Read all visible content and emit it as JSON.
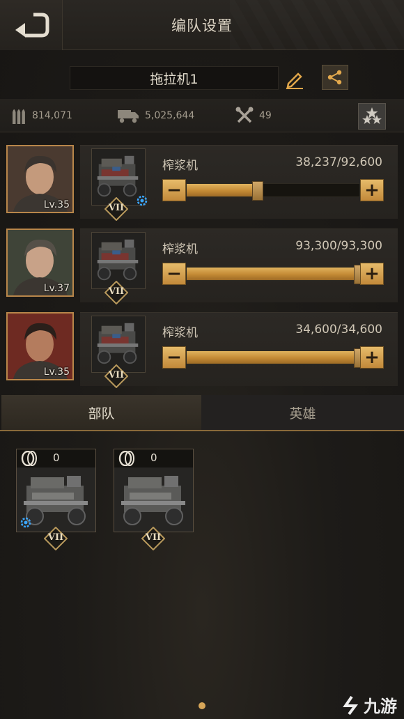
{
  "header": {
    "title": "编队设置",
    "back_icon": "back-arrow-icon"
  },
  "formation": {
    "name": "拖拉机1",
    "edit_icon": "pencil-icon",
    "share_icon": "share-icon"
  },
  "stats": {
    "ammo": "814,071",
    "ammo_icon": "bullets-icon",
    "transport": "5,025,644",
    "transport_icon": "truck-icon",
    "tools": "49",
    "tools_icon": "wrench-icon",
    "stars_icon": "stars-icon"
  },
  "squads": [
    {
      "hero_level": "Lv.35",
      "unit_name": "榨浆机",
      "count": "38,237/92,600",
      "fill": 0.4129,
      "tier": "VII",
      "has_gear": true
    },
    {
      "hero_level": "Lv.37",
      "unit_name": "榨浆机",
      "count": "93,300/93,300",
      "fill": 1.0,
      "tier": "VII",
      "has_gear": false
    },
    {
      "hero_level": "Lv.35",
      "unit_name": "榨浆机",
      "count": "34,600/34,600",
      "fill": 1.0,
      "tier": "VII",
      "has_gear": false
    }
  ],
  "tabs": [
    {
      "label": "部队",
      "active": true
    },
    {
      "label": "英雄",
      "active": false
    }
  ],
  "reserve_cards": [
    {
      "count": "0",
      "tier": "VII",
      "has_gear": true
    },
    {
      "count": "0",
      "tier": "VII",
      "has_gear": false
    }
  ],
  "controls": {
    "minus": "−",
    "plus": "+"
  },
  "watermark": "九游",
  "colors": {
    "accent": "#c48a35",
    "background": "#1c1a17",
    "gear": "#3ba7ff"
  }
}
